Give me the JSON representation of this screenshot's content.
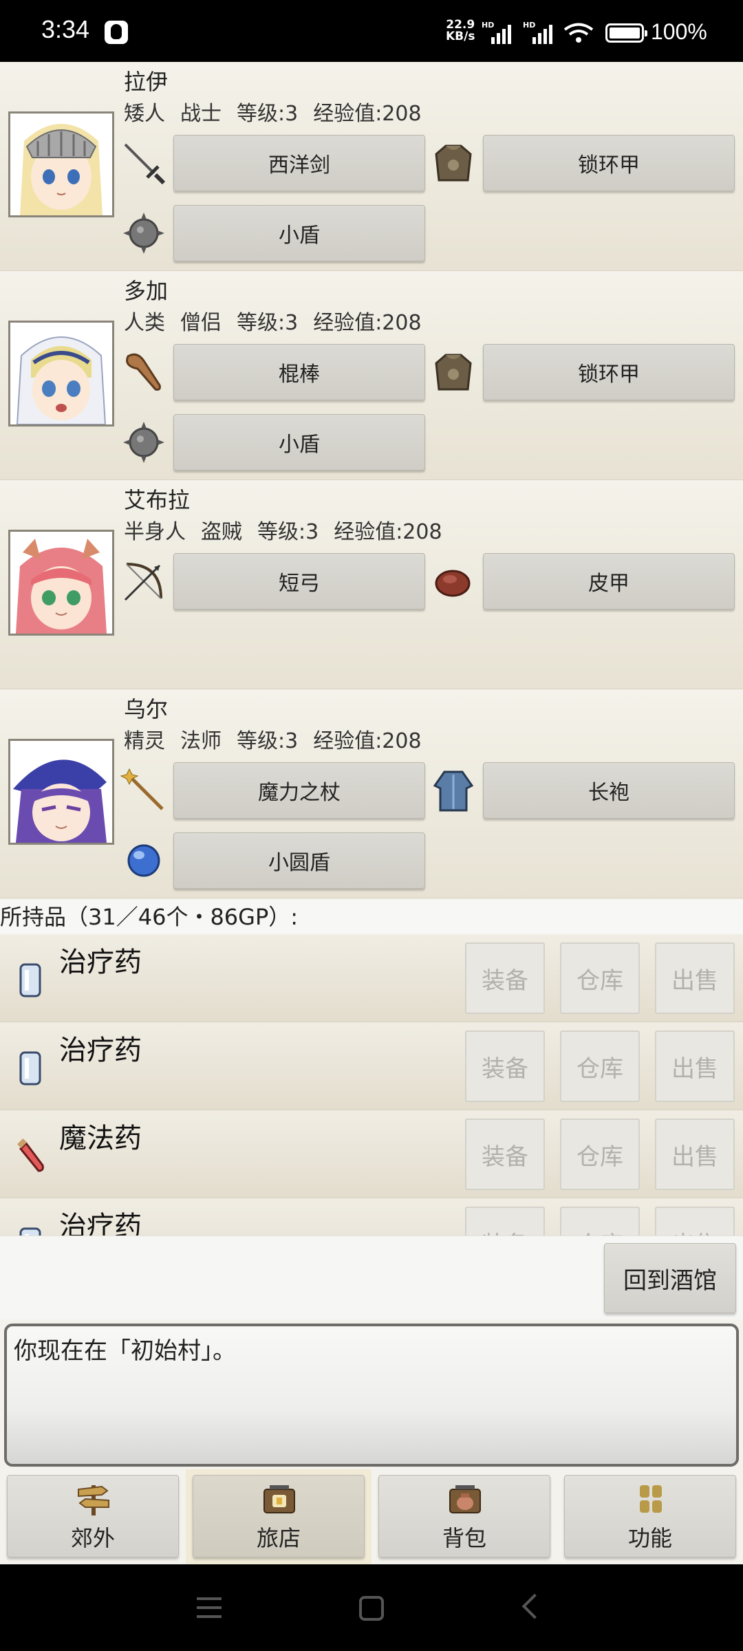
{
  "status_bar": {
    "time": "3:34",
    "net_speed_value": "22.9",
    "net_speed_unit": "KB/s",
    "signal_label": "HD",
    "battery": "100%"
  },
  "party": [
    {
      "name": "拉伊",
      "race": "矮人",
      "job": "战士",
      "level": "等级:3",
      "exp": "经验值:208",
      "portrait": "knight-girl",
      "weapon": {
        "icon": "sword-icon",
        "label": "西洋剑"
      },
      "armor": {
        "icon": "chainmail-icon",
        "label": "锁环甲"
      },
      "shield": {
        "icon": "spiked-shield-icon",
        "label": "小盾"
      }
    },
    {
      "name": "多加",
      "race": "人类",
      "job": "僧侣",
      "level": "等级:3",
      "exp": "经验值:208",
      "portrait": "priest-girl",
      "weapon": {
        "icon": "club-icon",
        "label": "棍棒"
      },
      "armor": {
        "icon": "chainmail-icon",
        "label": "锁环甲"
      },
      "shield": {
        "icon": "spiked-shield-icon",
        "label": "小盾"
      }
    },
    {
      "name": "艾布拉",
      "race": "半身人",
      "job": "盗贼",
      "level": "等级:3",
      "exp": "经验值:208",
      "portrait": "thief-girl",
      "weapon": {
        "icon": "bow-icon",
        "label": "短弓"
      },
      "armor": {
        "icon": "leather-armor-icon",
        "label": "皮甲"
      }
    },
    {
      "name": "乌尔",
      "race": "精灵",
      "job": "法师",
      "level": "等级:3",
      "exp": "经验值:208",
      "portrait": "mage-girl",
      "weapon": {
        "icon": "staff-icon",
        "label": "魔力之杖"
      },
      "armor": {
        "icon": "robe-icon",
        "label": "长袍"
      },
      "shield": {
        "icon": "buckler-icon",
        "label": "小圆盾"
      }
    }
  ],
  "inventory": {
    "title": "所持品（31／46个・86GP）:",
    "actions": {
      "equip": "装备",
      "store": "仓库",
      "sell": "出售"
    },
    "items": [
      {
        "name": "治疗药",
        "icon": "potion-bottle-icon"
      },
      {
        "name": "治疗药",
        "icon": "potion-bottle-icon"
      },
      {
        "name": "魔法药",
        "icon": "magic-vial-icon"
      },
      {
        "name": "治疗药",
        "icon": "potion-bottle-icon"
      }
    ]
  },
  "back_button": "回到酒馆",
  "message_log": "你现在在「初始村」。",
  "nav": [
    {
      "label": "郊外",
      "icon": "signpost-icon"
    },
    {
      "label": "旅店",
      "icon": "inn-sign-icon"
    },
    {
      "label": "背包",
      "icon": "bag-sign-icon"
    },
    {
      "label": "功能",
      "icon": "grid-icon"
    }
  ],
  "colors": {
    "row_bg_top": "#f4f2ea",
    "row_bg_bottom": "#e7e2d3",
    "button": "#d6d4ce",
    "disabled_text": "#b3b1ab",
    "active_tab_bg": "#f0ead6"
  }
}
